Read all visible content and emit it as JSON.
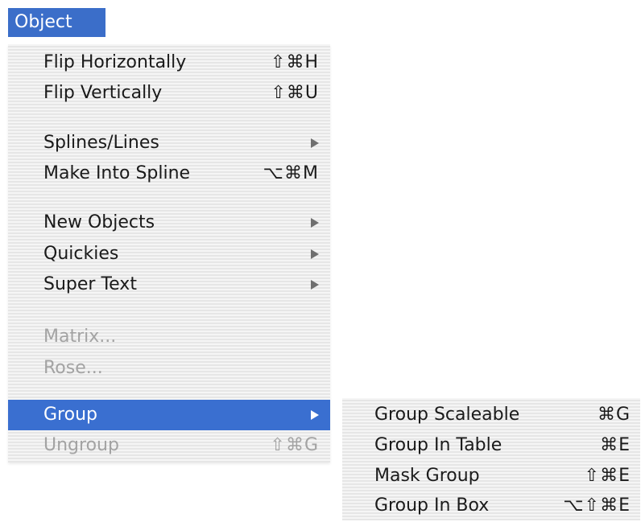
{
  "menu_bar": {
    "title": "Object"
  },
  "menu": {
    "items": [
      {
        "label": "Flip Horizontally",
        "shortcut": "⇧⌘H"
      },
      {
        "label": "Flip Vertically",
        "shortcut": "⇧⌘U"
      },
      {
        "label": "Splines/Lines",
        "submenu_arrow": "right-triangle-icon"
      },
      {
        "label": "Make Into Spline",
        "shortcut": "⌥⌘M"
      },
      {
        "label": "New Objects",
        "submenu_arrow": "right-triangle-icon"
      },
      {
        "label": "Quickies",
        "submenu_arrow": "right-triangle-icon"
      },
      {
        "label": "Super Text",
        "submenu_arrow": "right-triangle-icon"
      },
      {
        "label": "Matrix...",
        "disabled": true
      },
      {
        "label": "Rose...",
        "disabled": true
      },
      {
        "label": "Group",
        "submenu_arrow": "right-triangle-icon",
        "selected": true
      },
      {
        "label": "Ungroup",
        "shortcut": "⇧⌘G",
        "disabled": true
      }
    ]
  },
  "submenu": {
    "items": [
      {
        "label": "Group Scaleable",
        "shortcut": "⌘G"
      },
      {
        "label": "Group In Table",
        "shortcut": "⌘E"
      },
      {
        "label": "Mask Group",
        "shortcut": "⇧⌘E"
      },
      {
        "label": "Group In Box",
        "shortcut": "⌥⇧⌘E"
      }
    ]
  },
  "colors": {
    "highlight": "#3a6fd0",
    "menu_title_bg": "#3b6ec9",
    "disabled_text": "#a3a3a3",
    "text": "#1a1a1a"
  }
}
